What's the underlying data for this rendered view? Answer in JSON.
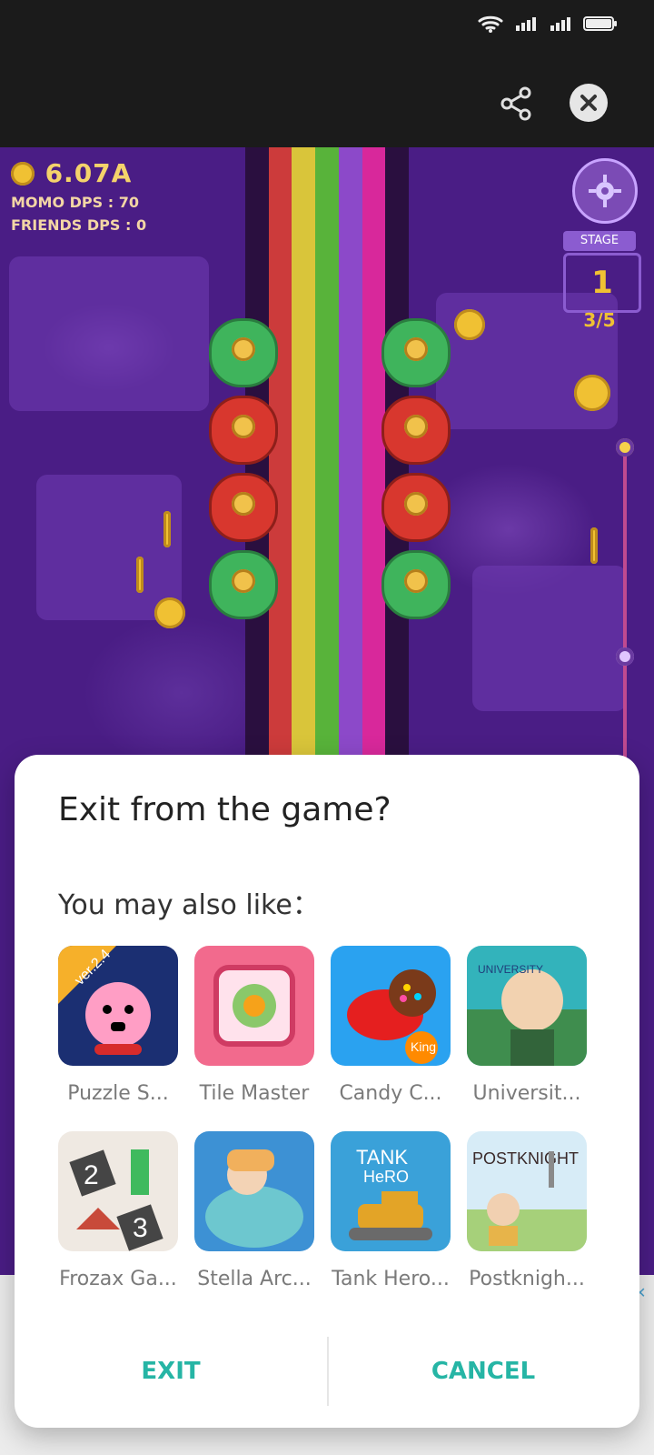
{
  "header": {
    "share_icon": "share-icon",
    "close_icon": "close-icon"
  },
  "game": {
    "gold": "6.07A",
    "momo_dps": "MOMO DPS : 70",
    "friends_dps": "FRIENDS DPS : 0",
    "stage_label": "STAGE",
    "stage_number": "1",
    "stage_progress": "3/5"
  },
  "dialog": {
    "title": "Exit from the game?",
    "subtitle": "You may also like：",
    "apps": [
      {
        "label": "Puzzle S...",
        "badge": "ver.2.4"
      },
      {
        "label": "Tile Master"
      },
      {
        "label": "Candy C...",
        "badge": "King"
      },
      {
        "label": "Universit...",
        "badge": "UNIVERSITY"
      },
      {
        "label": "Frozax Ga...",
        "num1": "2",
        "num2": "3"
      },
      {
        "label": "Stella Arc..."
      },
      {
        "label": "Tank Hero...",
        "title_line1": "TANK",
        "title_line2": "HeRO"
      },
      {
        "label": "Postknigh...",
        "title": "POSTKNIGHT"
      }
    ],
    "actions": {
      "exit": "EXIT",
      "cancel": "CANCEL"
    }
  },
  "colors": {
    "accent": "#26b5a5",
    "dialog_bg": "#ffffff",
    "game_bg": "#4a1d85"
  }
}
